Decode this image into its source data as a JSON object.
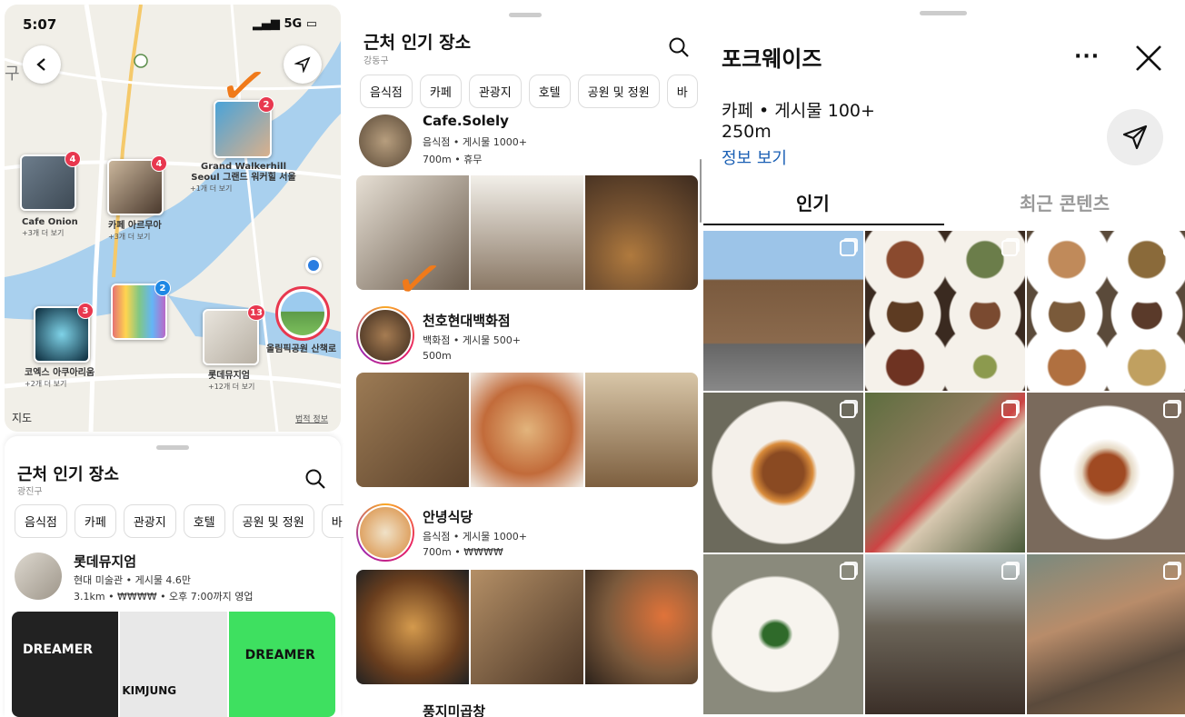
{
  "status": {
    "time": "5:07",
    "network": "5G"
  },
  "map": {
    "apple_maps_label": "지도",
    "legal_label": "법적 정보",
    "district_char": "구",
    "pins": [
      {
        "name": "Grand Walkerhill Seoul 그랜드 워커힐 서울",
        "more": "+1개 더 보기",
        "count": "2"
      },
      {
        "name": "Cafe Onion",
        "more": "+3개 더 보기",
        "count": "4"
      },
      {
        "name": "카페 아르무아",
        "more": "+3개 더 보기",
        "count": "4"
      },
      {
        "name": "코엑스 아쿠아리움",
        "more": "+2개 더 보기",
        "count": "3"
      },
      {
        "name": "",
        "more": "",
        "count": "2"
      },
      {
        "name": "롯데뮤지엄",
        "more": "+12개 더 보기",
        "count": "13"
      },
      {
        "name": "올림픽공원 산책로",
        "more": "",
        "count": ""
      }
    ]
  },
  "sheet1": {
    "title": "근처 인기 장소",
    "district": "광진구",
    "chips": [
      "음식점",
      "카페",
      "관광지",
      "호텔",
      "공원 및 정원",
      "바"
    ],
    "place": {
      "name": "롯데뮤지엄",
      "line1": "현대 미술관 • 게시물 4.6만",
      "line2": "3.1km • ₩₩₩₩ • 오후 7:00까지 영업"
    },
    "poster_texts": [
      "DREAMER",
      "KIMJUNG",
      "DREAMER"
    ]
  },
  "sheet2": {
    "title": "근처 인기 장소",
    "district": "강동구",
    "chips": [
      "음식점",
      "카페",
      "관광지",
      "호텔",
      "공원 및 정원",
      "바"
    ],
    "places": [
      {
        "name": "Cafe.Solely",
        "line1": "음식점 • 게시물 1000+",
        "line2": "700m • 휴무"
      },
      {
        "name": "천호현대백화점",
        "line1": "백화점 • 게시물 500+",
        "line2": "500m"
      },
      {
        "name": "안녕식당",
        "line1": "음식점 • 게시물 1000+",
        "line2": "700m • ₩₩₩₩"
      },
      {
        "name": "풍지미곱창",
        "line1": "",
        "line2": ""
      }
    ]
  },
  "detail": {
    "title": "포크웨이즈",
    "category": "카페 • 게시물 100+",
    "distance": "250m",
    "info_link": "정보 보기",
    "tabs": [
      "인기",
      "최근 콘텐츠"
    ],
    "accent": "#1a5fb4"
  }
}
